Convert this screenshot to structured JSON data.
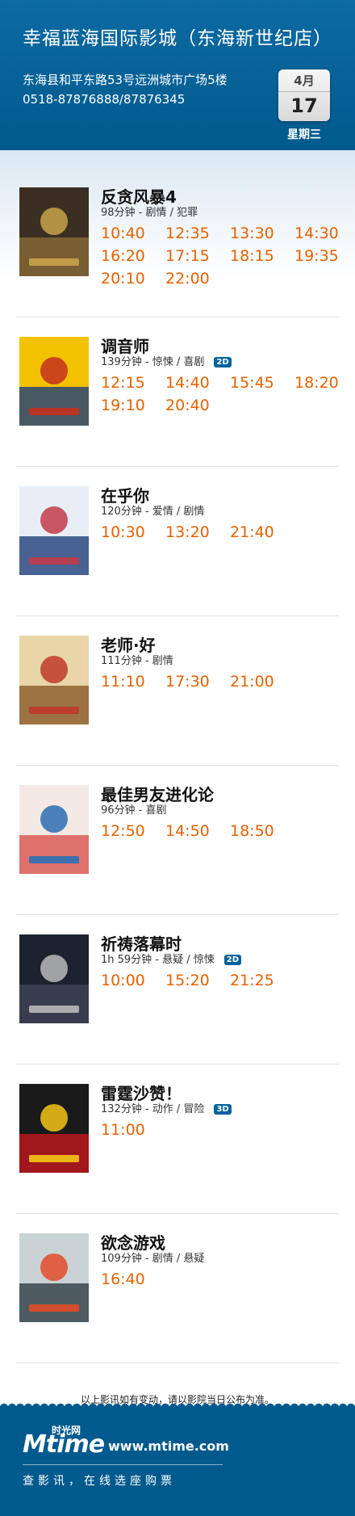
{
  "header": {
    "cinema_name": "幸福蓝海国际影城（东海新世纪店）",
    "address": "东海县和平东路53号远洲城市广场5楼",
    "phone": "0518-87876888/87876345",
    "month": "4月",
    "day": "17",
    "weekday": "星期三"
  },
  "movies": [
    {
      "title": "反贪风暴4",
      "meta": "98分钟 - 剧情 / 犯罪",
      "badge": "",
      "times": [
        "10:40",
        "12:35",
        "13:30",
        "14:30",
        "16:20",
        "17:15",
        "18:15",
        "19:35",
        "20:10",
        "22:00"
      ],
      "poster_colors": [
        "#3a2f22",
        "#8a6a3a",
        "#c9a24a"
      ]
    },
    {
      "title": "调音师",
      "meta": "139分钟 - 惊悚 / 喜剧",
      "badge": "2D",
      "times": [
        "12:15",
        "14:40",
        "15:45",
        "18:20",
        "19:10",
        "20:40"
      ],
      "poster_colors": [
        "#f2c200",
        "#1d3e7a",
        "#c4301e"
      ]
    },
    {
      "title": "在乎你",
      "meta": "120分钟 - 爱情 / 剧情",
      "badge": "",
      "times": [
        "10:30",
        "13:20",
        "21:40"
      ],
      "poster_colors": [
        "#e9eef5",
        "#1f3f7a",
        "#c23b4a"
      ]
    },
    {
      "title": "老师·好",
      "meta": "111分钟 - 剧情",
      "badge": "",
      "times": [
        "11:10",
        "17:30",
        "21:00"
      ],
      "poster_colors": [
        "#e8d5a8",
        "#8a5a2a",
        "#c0392b"
      ]
    },
    {
      "title": "最佳男友进化论",
      "meta": "96分钟 - 喜剧",
      "badge": "",
      "times": [
        "12:50",
        "14:50",
        "18:50"
      ],
      "poster_colors": [
        "#f4e9e4",
        "#d9534f",
        "#2c6fb3"
      ]
    },
    {
      "title": "祈祷落幕时",
      "meta": "1h 59分钟 - 悬疑 / 惊悚",
      "badge": "2D",
      "times": [
        "10:00",
        "15:20",
        "21:25"
      ],
      "poster_colors": [
        "#1d2230",
        "#3e4458",
        "#b8b8b8"
      ]
    },
    {
      "title": "雷霆沙赞！",
      "meta": "132分钟 - 动作 / 冒险",
      "badge": "3D",
      "times": [
        "11:00"
      ],
      "poster_colors": [
        "#1a1a1a",
        "#c3161c",
        "#f5c518"
      ]
    },
    {
      "title": "欲念游戏",
      "meta": "109分钟 - 剧情 / 悬疑",
      "badge": "",
      "times": [
        "16:40"
      ],
      "poster_colors": [
        "#c9d3d6",
        "#2f3d44",
        "#e34b2a"
      ]
    }
  ],
  "notice": "以上影讯如有变动，请以影院当日公布为准。",
  "footer": {
    "logo_text": "Mtime",
    "logo_sub": "时光网",
    "site": "www.mtime.com",
    "slogan": "查影讯，在线选座购票"
  },
  "colors": {
    "brand_blue": "#005a8d",
    "time_orange": "#e86100"
  }
}
